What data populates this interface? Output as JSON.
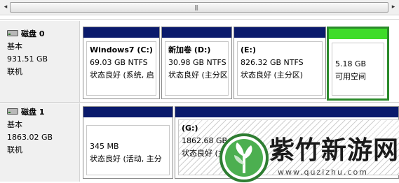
{
  "scrollbar": {
    "left_arrow": "◂",
    "right_arrow": "▸",
    "grip": "|||"
  },
  "disks": [
    {
      "name": "磁盘 0",
      "type": "基本",
      "size": "931.51 GB",
      "status": "联机",
      "partitions": [
        {
          "title": "Windows7  (C:)",
          "line1": "69.03 GB NTFS",
          "line2": "状态良好 (系统, 启"
        },
        {
          "title": "新加卷  (D:)",
          "line1": "30.98 GB NTFS",
          "line2": "状态良好 (主分区"
        },
        {
          "title": "(E:)",
          "line1": "826.32 GB NTFS",
          "line2": "状态良好 (主分区)"
        },
        {
          "title": "",
          "line1": "5.18 GB",
          "line2": "可用空间"
        }
      ]
    },
    {
      "name": "磁盘 1",
      "type": "基本",
      "size": "1863.02 GB",
      "status": "联机",
      "partitions": [
        {
          "title": "",
          "line1": "345 MB",
          "line2": "状态良好 (活动, 主分"
        },
        {
          "title": "(G:)",
          "line1": "1862.68 GB NTFS",
          "line2": "状态良好 (主分区"
        }
      ]
    }
  ],
  "watermark": {
    "text": "紫竹新游网",
    "url": "www.quzizhu.com"
  },
  "colors": {
    "primary_bar": "#0a1a6c",
    "free_bar": "#3fdc2a",
    "free_border": "#2a8a2a"
  }
}
